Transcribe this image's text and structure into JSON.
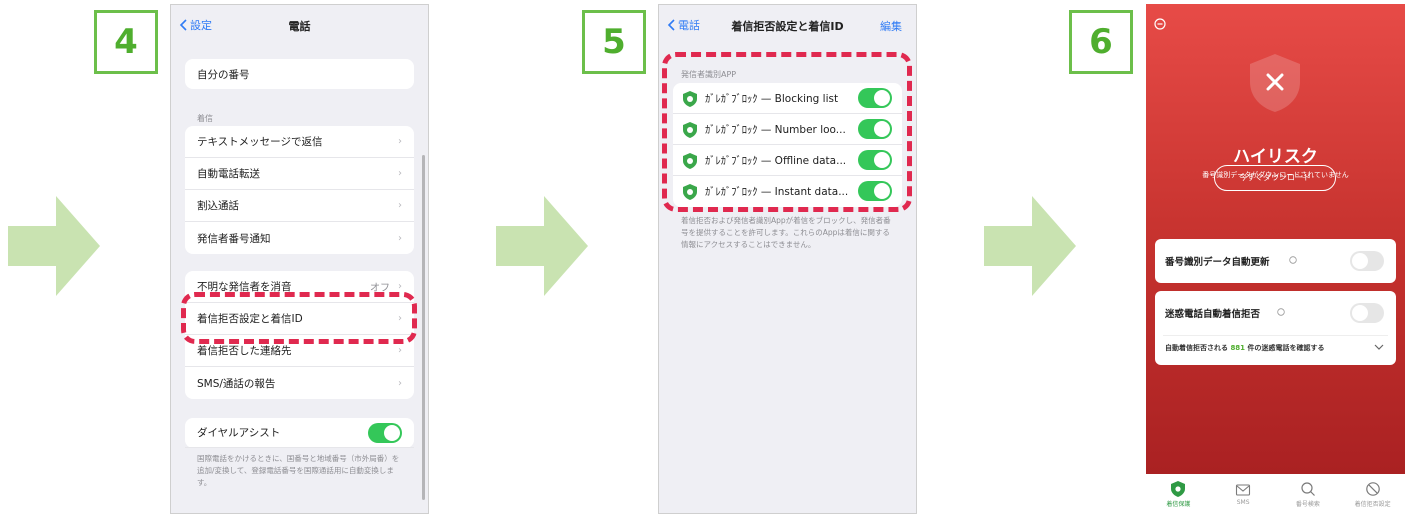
{
  "steps": [
    "4",
    "5",
    "6"
  ],
  "colors": {
    "accent_green": "#4fae2e",
    "arrow_green": "#c9e3b1",
    "highlight_red": "#e0294f",
    "ios_blue": "#2f7bf5",
    "toggle_on": "#34c759",
    "app_red": "#c7332f"
  },
  "screen4": {
    "back_label": "設定",
    "title": "電話",
    "my_number": "自分の番号",
    "section_incoming": "着信",
    "group1": [
      "テキストメッセージで返信",
      "自動電話転送",
      "割込通話",
      "発信者番号通知"
    ],
    "silence_unknown": {
      "label": "不明な発信者を消音",
      "value": "オフ"
    },
    "call_blocking_id": "着信拒否設定と着信ID",
    "blocked_contacts": "着信拒否した連絡先",
    "sms_call_report": "SMS/通話の報告",
    "dial_assist": {
      "label": "ダイヤルアシスト",
      "on": true
    },
    "dial_assist_note": "国際電話をかけるときに、国番号と地域番号（市外局番）を追加/変換して、登録電話番号を国際通話用に自動変換します。"
  },
  "screen5": {
    "back_label": "電話",
    "title": "着信拒否設定と着信ID",
    "edit_label": "編集",
    "section_label": "発信者識別APP",
    "items": [
      {
        "label": "ｶﾞﾚｶﾞﾌﾞﾛｯｸ — Blocking list",
        "on": true
      },
      {
        "label": "ｶﾞﾚｶﾞﾌﾞﾛｯｸ — Number loo...",
        "on": true
      },
      {
        "label": "ｶﾞﾚｶﾞﾌﾞﾛｯｸ — Offline data...",
        "on": true
      },
      {
        "label": "ｶﾞﾚｶﾞﾌﾞﾛｯｸ — Instant data...",
        "on": true
      }
    ],
    "note": "着信拒否および発信者識別Appが着信をブロックし、発信者番号を提供することを許可します。これらのAppは着信に関する情報にアクセスすることはできません。"
  },
  "screen6": {
    "risk_title": "ハイリスク",
    "risk_subtitle": "番号識別データがダウンロードされていません",
    "download_button": "今すぐダウンロード",
    "auto_update": {
      "label": "番号識別データ自動更新",
      "on": false
    },
    "auto_block": {
      "label": "迷惑電話自動着信拒否",
      "on": false
    },
    "check_prefix": "自動着信拒否される",
    "check_count": "881",
    "check_suffix": "件の迷惑電話を確認する",
    "tabs": [
      {
        "label": "着信保護",
        "icon": "shield-icon"
      },
      {
        "label": "SMS",
        "icon": "mail-icon"
      },
      {
        "label": "番号検索",
        "icon": "search-icon"
      },
      {
        "label": "着信拒否設定",
        "icon": "block-icon"
      }
    ]
  }
}
